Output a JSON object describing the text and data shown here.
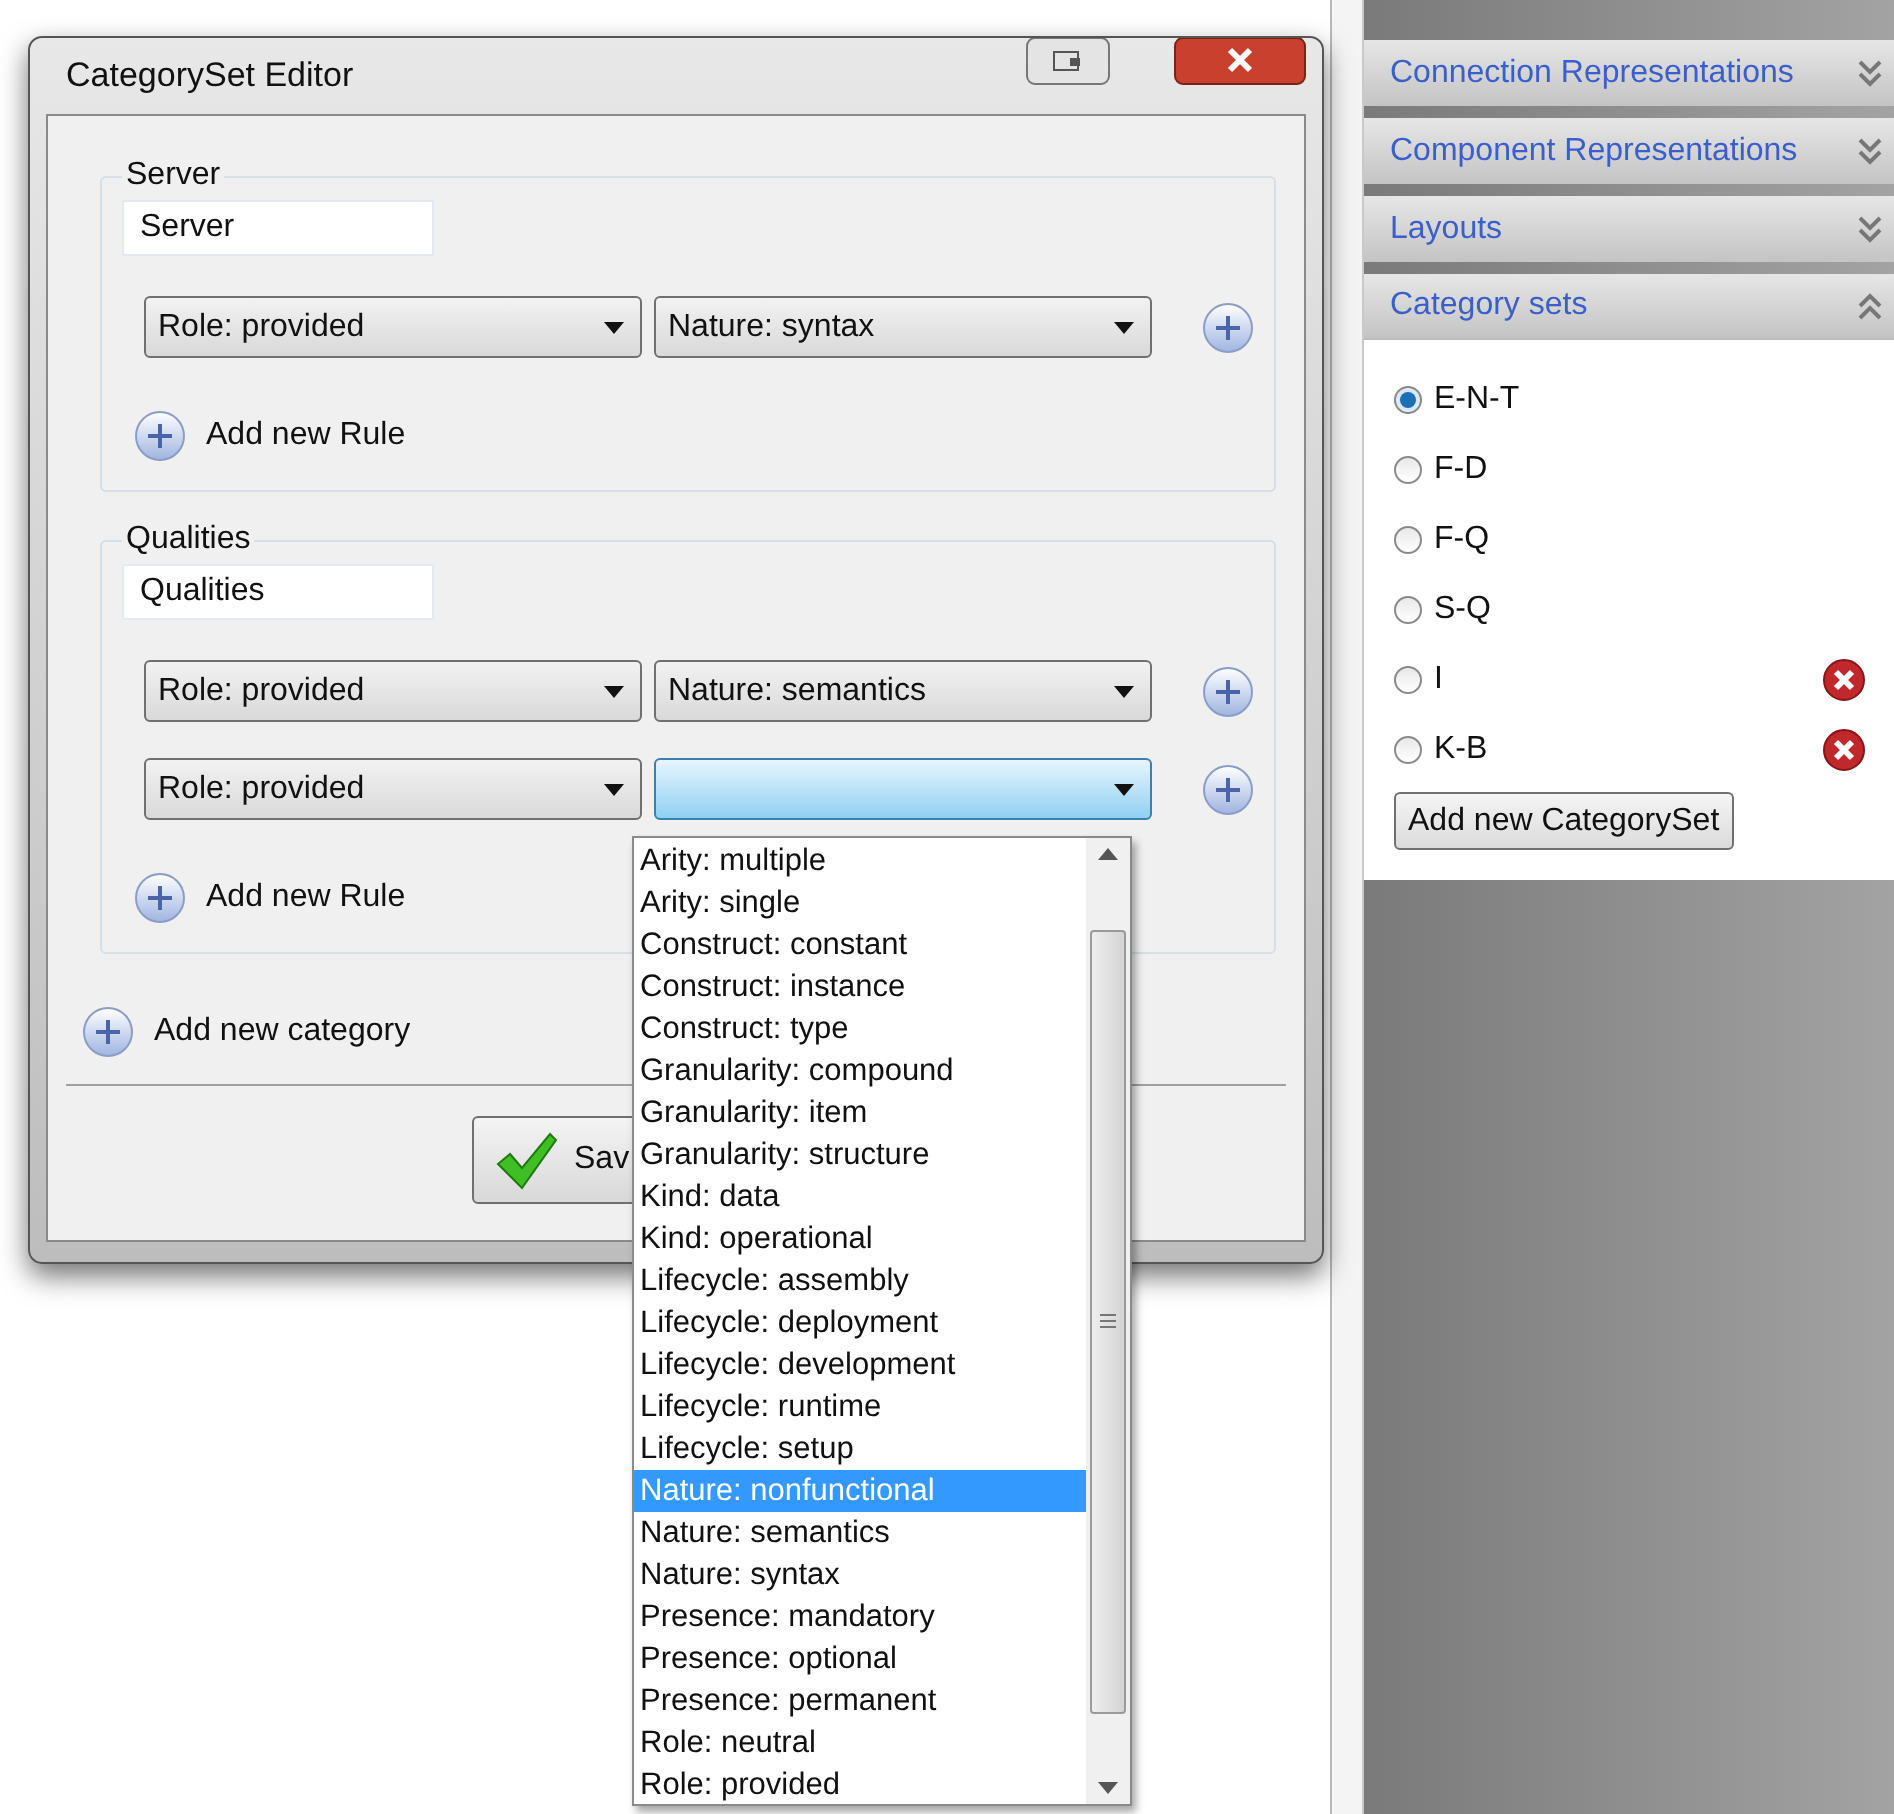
{
  "window": {
    "title": "CategorySet Editor"
  },
  "categories": [
    {
      "legend": "Server",
      "name": "Server",
      "rules": [
        {
          "role": "Role: provided",
          "nature": "Nature: syntax",
          "focused": false
        }
      ],
      "add_rule": "Add new Rule"
    },
    {
      "legend": "Qualities",
      "name": "Qualities",
      "rules": [
        {
          "role": "Role: provided",
          "nature": "Nature: semantics",
          "focused": false
        },
        {
          "role": "Role: provided",
          "focused": true
        }
      ],
      "add_rule": "Add new Rule"
    }
  ],
  "add_category": "Add new category",
  "save_button": "Sav",
  "dropdown": {
    "items": [
      {
        "label": "Arity: multiple",
        "selected": false
      },
      {
        "label": "Arity: single",
        "selected": false
      },
      {
        "label": "Construct: constant",
        "selected": false
      },
      {
        "label": "Construct: instance",
        "selected": false
      },
      {
        "label": "Construct: type",
        "selected": false
      },
      {
        "label": "Granularity: compound",
        "selected": false
      },
      {
        "label": "Granularity: item",
        "selected": false
      },
      {
        "label": "Granularity: structure",
        "selected": false
      },
      {
        "label": "Kind: data",
        "selected": false
      },
      {
        "label": "Kind: operational",
        "selected": false
      },
      {
        "label": "Lifecycle: assembly",
        "selected": false
      },
      {
        "label": "Lifecycle: deployment",
        "selected": false
      },
      {
        "label": "Lifecycle: development",
        "selected": false
      },
      {
        "label": "Lifecycle: runtime",
        "selected": false
      },
      {
        "label": "Lifecycle: setup",
        "selected": false
      },
      {
        "label": "Nature: nonfunctional",
        "selected": true
      },
      {
        "label": "Nature: semantics",
        "selected": false
      },
      {
        "label": "Nature: syntax",
        "selected": false
      },
      {
        "label": "Presence: mandatory",
        "selected": false
      },
      {
        "label": "Presence: optional",
        "selected": false
      },
      {
        "label": "Presence: permanent",
        "selected": false
      },
      {
        "label": "Role: neutral",
        "selected": false
      },
      {
        "label": "Role: provided",
        "selected": false
      }
    ]
  },
  "panel": {
    "sections": [
      {
        "title": "Connection Representations",
        "expanded": false
      },
      {
        "title": "Component Representations",
        "expanded": false
      },
      {
        "title": "Layouts",
        "expanded": false
      },
      {
        "title": "Category sets",
        "expanded": true
      }
    ],
    "category_sets": [
      {
        "label": "E-N-T",
        "selected": true,
        "deletable": false
      },
      {
        "label": "F-D",
        "selected": false,
        "deletable": false
      },
      {
        "label": "F-Q",
        "selected": false,
        "deletable": false
      },
      {
        "label": "S-Q",
        "selected": false,
        "deletable": false
      },
      {
        "label": "I",
        "selected": false,
        "deletable": true
      },
      {
        "label": "K-B",
        "selected": false,
        "deletable": true
      }
    ],
    "add_button": "Add new CategorySet"
  }
}
